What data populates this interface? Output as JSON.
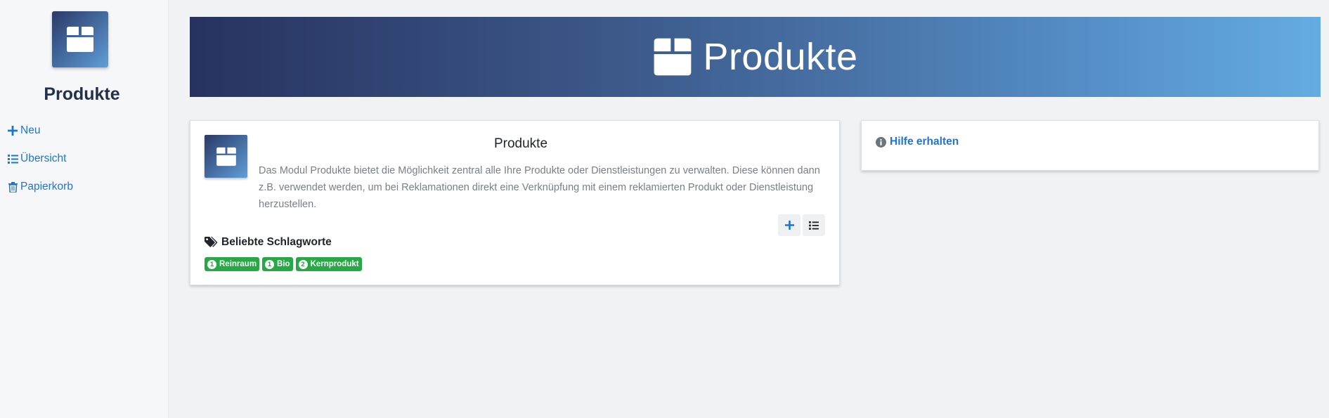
{
  "sidebar": {
    "logo_icon": "box-icon",
    "title": "Produkte",
    "items": [
      {
        "label": "Neu",
        "icon": "plus-icon"
      },
      {
        "label": "Übersicht",
        "icon": "list-icon"
      },
      {
        "label": "Papierkorb",
        "icon": "trash-icon"
      }
    ]
  },
  "banner": {
    "icon": "box-icon",
    "title": "Produkte"
  },
  "module_card": {
    "icon": "box-icon",
    "title": "Produkte",
    "description": "Das Modul Produkte bietet die Möglichkeit zentral alle Ihre Produkte oder Dienstleistungen zu verwalten. Diese können dann z.B. verwendet werden, um bei Reklamationen direkt eine Verknüpfung mit einem reklamierten Produkt oder Dienstleistung herzustellen.",
    "actions": [
      {
        "icon": "plus-icon"
      },
      {
        "icon": "list-icon"
      }
    ],
    "tags_heading": "Beliebte Schlagworte",
    "tags": [
      {
        "count": "1",
        "label": "Reinraum"
      },
      {
        "count": "1",
        "label": "Bio"
      },
      {
        "count": "2",
        "label": "Kernprodukt"
      }
    ]
  },
  "help_card": {
    "icon": "info-icon",
    "link_label": "Hilfe erhalten"
  },
  "colors": {
    "accent": "#1f74d0",
    "tag": "#28a745",
    "banner_start": "#27325f",
    "banner_end": "#63ace1"
  }
}
